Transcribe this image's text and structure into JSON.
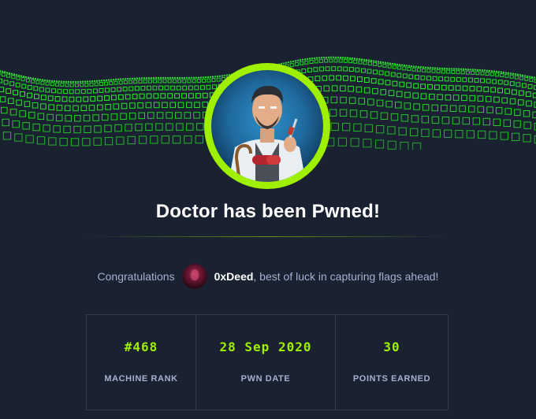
{
  "title": "Doctor has been Pwned!",
  "congrats": {
    "prefix": "Congratulations",
    "username": "0xDeed",
    "suffix": ", best of luck in capturing flags ahead!"
  },
  "stats": [
    {
      "value": "#468",
      "label": "MACHINE RANK"
    },
    {
      "value": "28 Sep 2020",
      "label": "PWN DATE"
    },
    {
      "value": "30",
      "label": "POINTS EARNED"
    }
  ],
  "colors": {
    "background": "#1a2232",
    "accent": "#9fef00",
    "text_muted": "#a4b1cd",
    "border": "#2f3a4e"
  },
  "icons": {
    "banner": "green-cube-grid-banner",
    "machine_avatar": "doctor-avatar",
    "user_avatar": "user-avatar"
  }
}
